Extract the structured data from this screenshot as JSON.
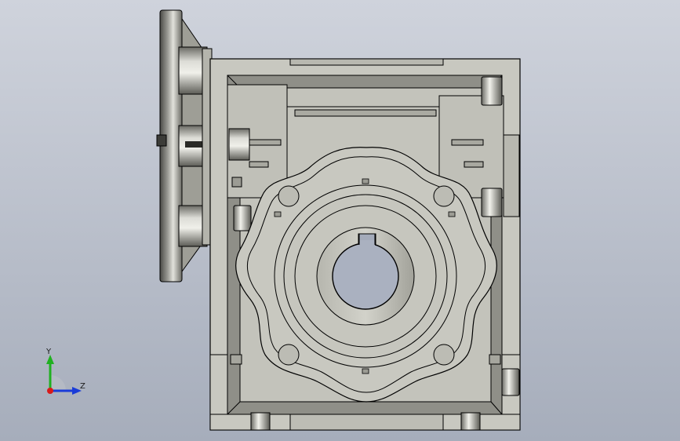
{
  "viewport": {
    "background_top": "#cfd3dc",
    "background_bottom": "#a6adbb"
  },
  "model": {
    "body_color": "#c8c8c0",
    "shadow_color": "#8f8f88",
    "edge_color": "#000000",
    "flange_dark": "#4a4a46",
    "flange_light": "#e2e2dc"
  },
  "triad": {
    "y_label": "Y",
    "z_label": "Z",
    "y_color": "#20b020",
    "z_color": "#1a3cd8",
    "x_color": "#d81a1a"
  }
}
